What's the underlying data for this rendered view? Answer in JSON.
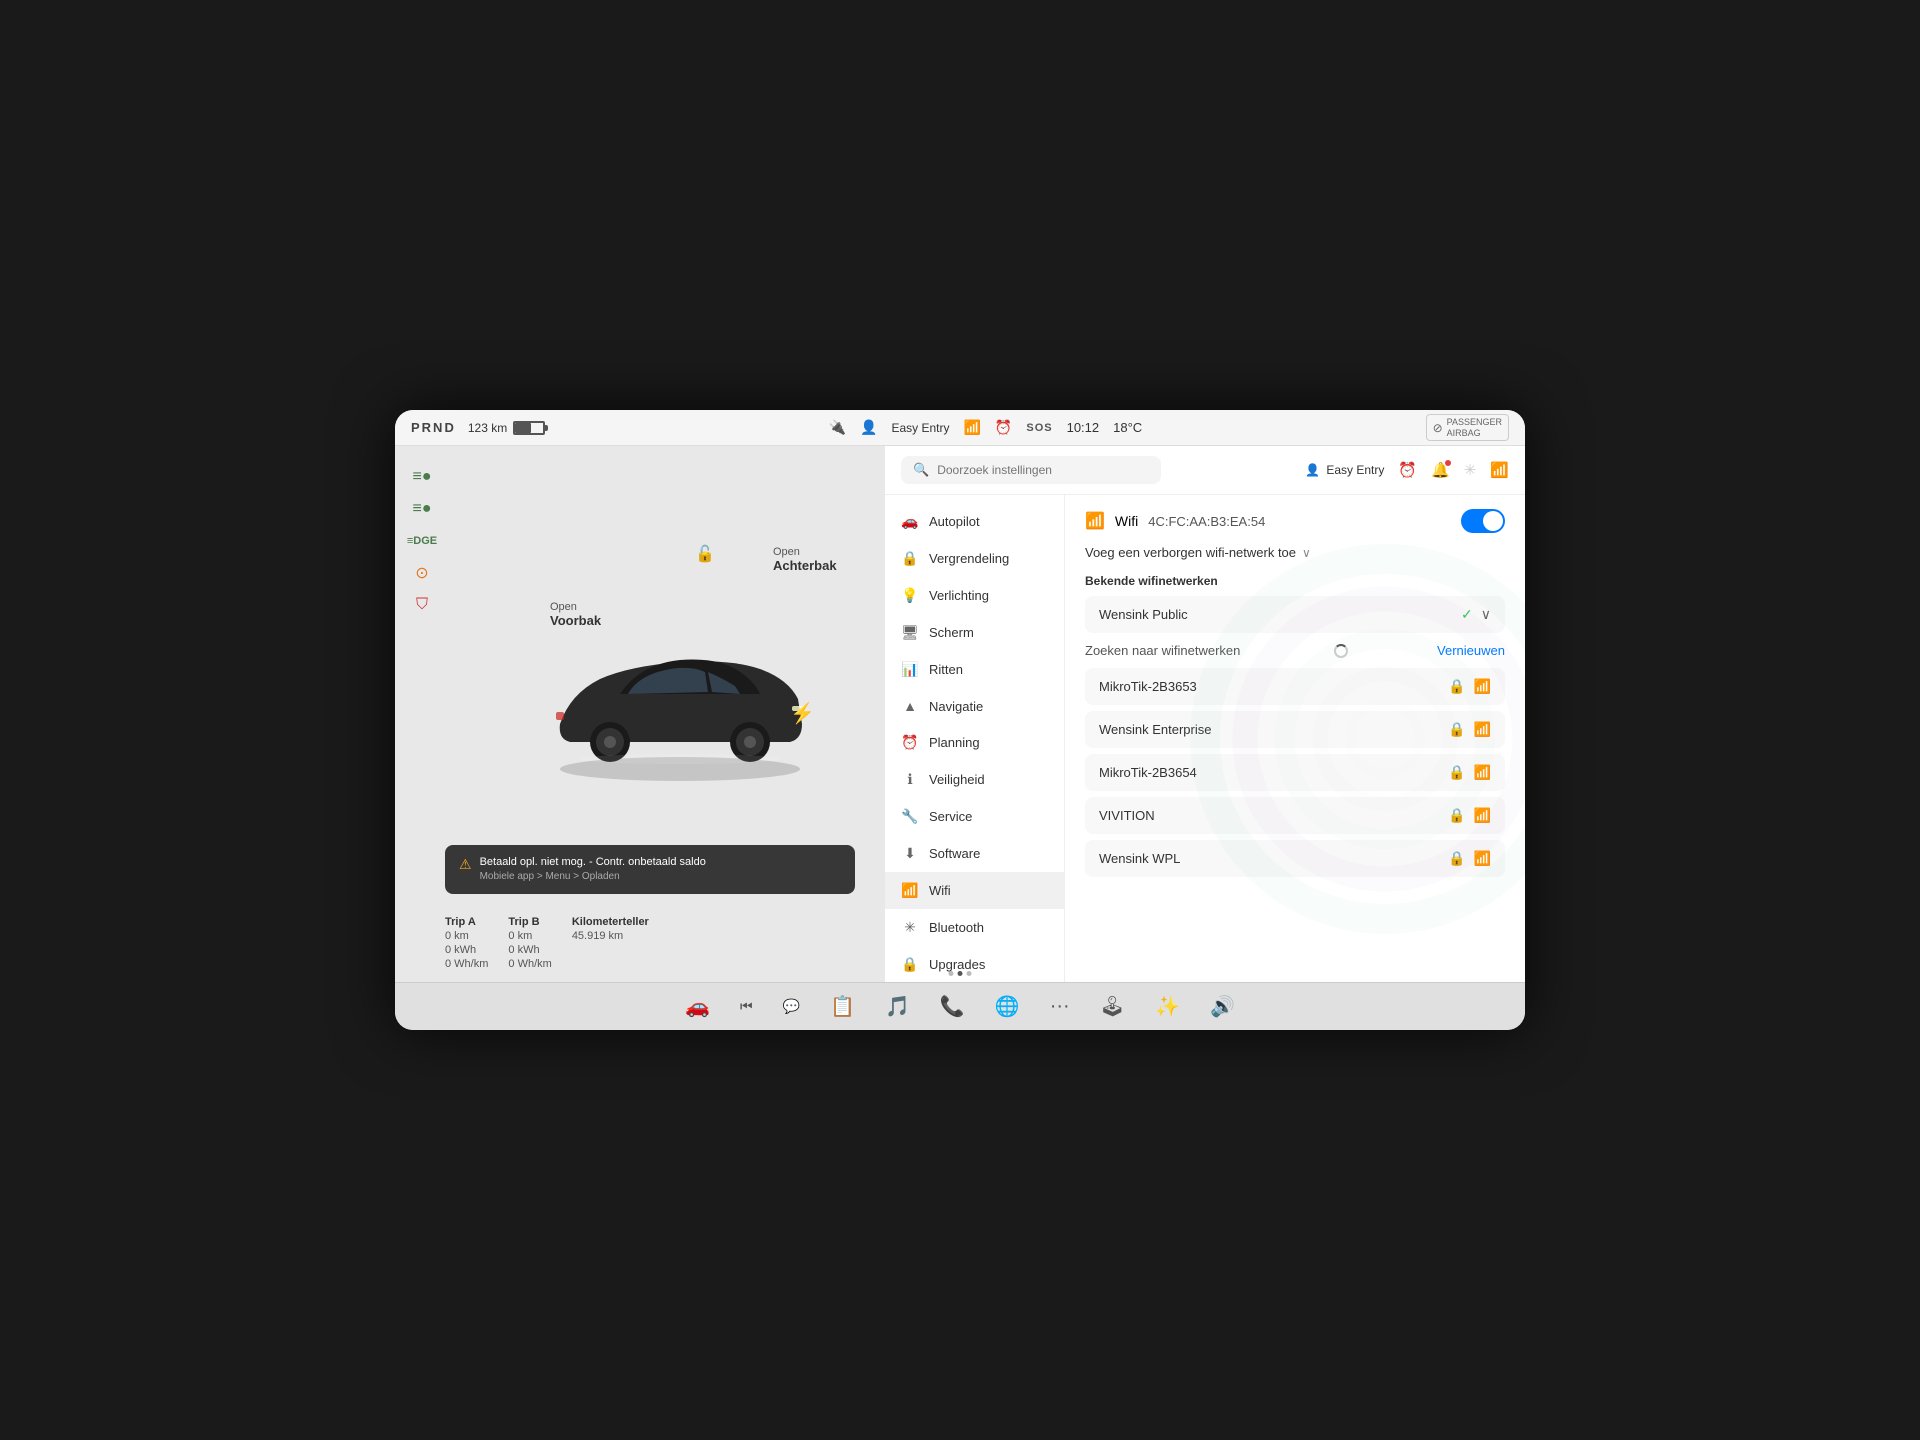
{
  "statusBar": {
    "prnd": "PRND",
    "battery_km": "123 km",
    "usb_icon": "🔌",
    "user_icon": "👤",
    "profile": "Easy Entry",
    "wifi_icon": "wifi",
    "alarm_icon": "alarm",
    "sos": "SOS",
    "time": "10:12",
    "temperature": "18°C",
    "airbag_label": "PASSENGER\nAIRBAG"
  },
  "header": {
    "search_placeholder": "Doorzoek instellingen",
    "user_label": "Easy Entry",
    "alarm_icon": "alarm",
    "bell_icon": "bell",
    "bt_icon": "bluetooth",
    "wifi_icon": "wifi"
  },
  "nav": {
    "items": [
      {
        "id": "autopilot",
        "label": "Autopilot",
        "icon": "🚗"
      },
      {
        "id": "vergrendeling",
        "label": "Vergrendeling",
        "icon": "🔒"
      },
      {
        "id": "verlichting",
        "label": "Verlichting",
        "icon": "💡"
      },
      {
        "id": "scherm",
        "label": "Scherm",
        "icon": "🖥"
      },
      {
        "id": "ritten",
        "label": "Ritten",
        "icon": "📊"
      },
      {
        "id": "navigatie",
        "label": "Navigatie",
        "icon": "🗺"
      },
      {
        "id": "planning",
        "label": "Planning",
        "icon": "⏰"
      },
      {
        "id": "veiligheid",
        "label": "Veiligheid",
        "icon": "ℹ️"
      },
      {
        "id": "service",
        "label": "Service",
        "icon": "🔧"
      },
      {
        "id": "software",
        "label": "Software",
        "icon": "⬇️"
      },
      {
        "id": "wifi",
        "label": "Wifi",
        "icon": "📶",
        "active": true
      },
      {
        "id": "bluetooth",
        "label": "Bluetooth",
        "icon": "🔵"
      },
      {
        "id": "upgrades",
        "label": "Upgrades",
        "icon": "🔒"
      }
    ]
  },
  "wifi": {
    "title": "Wifi",
    "mac_label": "4C:FC:AA:B3:EA:54",
    "toggle_on": true,
    "add_hidden_label": "Voeg een verborgen wifi-netwerk toe",
    "known_section": "Bekende wifinetwerken",
    "known_networks": [
      {
        "name": "Wensink Public",
        "connected": true
      }
    ],
    "searching_label": "Zoeken naar wifinetwerken",
    "refresh_label": "Vernieuwen",
    "found_networks": [
      {
        "name": "MikroTik-2B3653",
        "locked": true,
        "signal": 3
      },
      {
        "name": "Wensink Enterprise",
        "locked": true,
        "signal": 2
      },
      {
        "name": "MikroTik-2B3654",
        "locked": true,
        "signal": 2
      },
      {
        "name": "VIVITION",
        "locked": true,
        "signal": 1
      },
      {
        "name": "Wensink WPL",
        "locked": true,
        "signal": 1
      }
    ]
  },
  "car": {
    "open_voorbak": "Open\nVoorbak",
    "open_achterbak": "Open\nAchterbak",
    "warning_main": "Betaald opl. niet mog. - Contr. onbetaald saldo",
    "warning_sub": "Mobiele app > Menu > Opladen"
  },
  "trips": {
    "trip_a_label": "Trip A",
    "trip_a_km": "0 km",
    "trip_a_kwh": "0 kWh",
    "trip_a_whkm": "0 Wh/km",
    "trip_b_label": "Trip B",
    "trip_b_km": "0 km",
    "trip_b_kwh": "0 kWh",
    "trip_b_whkm": "0 Wh/km",
    "odometer_label": "Kilometerteller",
    "odometer_value": "45.919 km"
  },
  "taskbar": {
    "icons": [
      "🚗",
      "🔊",
      "📋",
      "🎵",
      "📞",
      "🌐",
      "···",
      "🕹",
      "✨",
      "🔊"
    ]
  }
}
